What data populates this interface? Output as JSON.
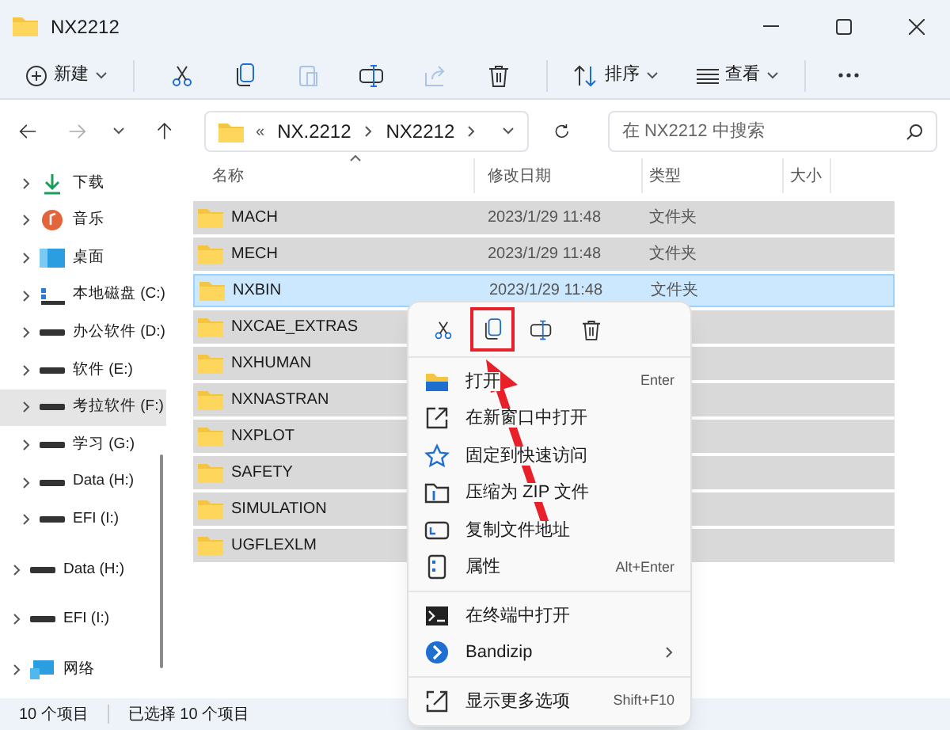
{
  "window": {
    "title": "NX2212"
  },
  "toolbar": {
    "new_label": "新建",
    "sort_label": "排序",
    "view_label": "查看"
  },
  "address": {
    "overflow": "«",
    "crumbs": [
      "NX.2212",
      "NX2212"
    ]
  },
  "search": {
    "placeholder": "在 NX2212 中搜索"
  },
  "sidebar": {
    "items": [
      {
        "label": "下载",
        "kind": "download",
        "selected": false
      },
      {
        "label": "音乐",
        "kind": "music",
        "selected": false
      },
      {
        "label": "桌面",
        "kind": "desktop",
        "selected": false
      },
      {
        "label": "本地磁盘 (C:)",
        "kind": "system",
        "selected": false
      },
      {
        "label": "办公软件 (D:)",
        "kind": "drive",
        "selected": false
      },
      {
        "label": "软件 (E:)",
        "kind": "drive",
        "selected": false
      },
      {
        "label": "考拉软件 (F:)",
        "kind": "drive",
        "selected": true
      },
      {
        "label": "学习 (G:)",
        "kind": "drive",
        "selected": false
      },
      {
        "label": "Data (H:)",
        "kind": "drive",
        "selected": false
      },
      {
        "label": "EFI (I:)",
        "kind": "drive",
        "selected": false
      },
      {
        "label": "Data (H:)",
        "kind": "drive",
        "selected": false
      },
      {
        "label": "EFI (I:)",
        "kind": "drive",
        "selected": false
      },
      {
        "label": "网络",
        "kind": "network",
        "selected": false
      }
    ]
  },
  "table": {
    "columns": [
      "名称",
      "修改日期",
      "类型",
      "大小"
    ],
    "rows": [
      {
        "name": "MACH",
        "date": "2023/1/29 11:48",
        "type": "文件夹",
        "selected": true,
        "focused": false
      },
      {
        "name": "MECH",
        "date": "2023/1/29 11:48",
        "type": "文件夹",
        "selected": true,
        "focused": false
      },
      {
        "name": "NXBIN",
        "date": "2023/1/29 11:48",
        "type": "文件夹",
        "selected": true,
        "focused": true
      },
      {
        "name": "NXCAE_EXTRAS",
        "selected": true,
        "focused": false
      },
      {
        "name": "NXHUMAN",
        "selected": true,
        "focused": false
      },
      {
        "name": "NXNASTRAN",
        "selected": true,
        "focused": false
      },
      {
        "name": "NXPLOT",
        "selected": true,
        "focused": false
      },
      {
        "name": "SAFETY",
        "selected": true,
        "focused": false
      },
      {
        "name": "SIMULATION",
        "selected": true,
        "focused": false
      },
      {
        "name": "UGFLEXLM",
        "selected": true,
        "focused": false
      }
    ]
  },
  "context_menu": {
    "items": [
      {
        "label": "打开",
        "kind": "open",
        "shortcut": "Enter"
      },
      {
        "label": "在新窗口中打开",
        "kind": "newwindow"
      },
      {
        "label": "固定到快速访问",
        "kind": "pin"
      },
      {
        "label": "压缩为 ZIP 文件",
        "kind": "zip"
      },
      {
        "label": "复制文件地址",
        "kind": "path"
      },
      {
        "label": "属性",
        "kind": "properties",
        "shortcut": "Alt+Enter"
      },
      {
        "kind": "separator"
      },
      {
        "label": "在终端中打开",
        "kind": "terminal"
      },
      {
        "label": "Bandizip",
        "kind": "bandizip",
        "submenu": true
      },
      {
        "kind": "separator"
      },
      {
        "label": "显示更多选项",
        "kind": "more",
        "shortcut": "Shift+F10"
      }
    ]
  },
  "status_bar": {
    "count": "10 个项目",
    "selection": "已选择 10 个项目"
  }
}
